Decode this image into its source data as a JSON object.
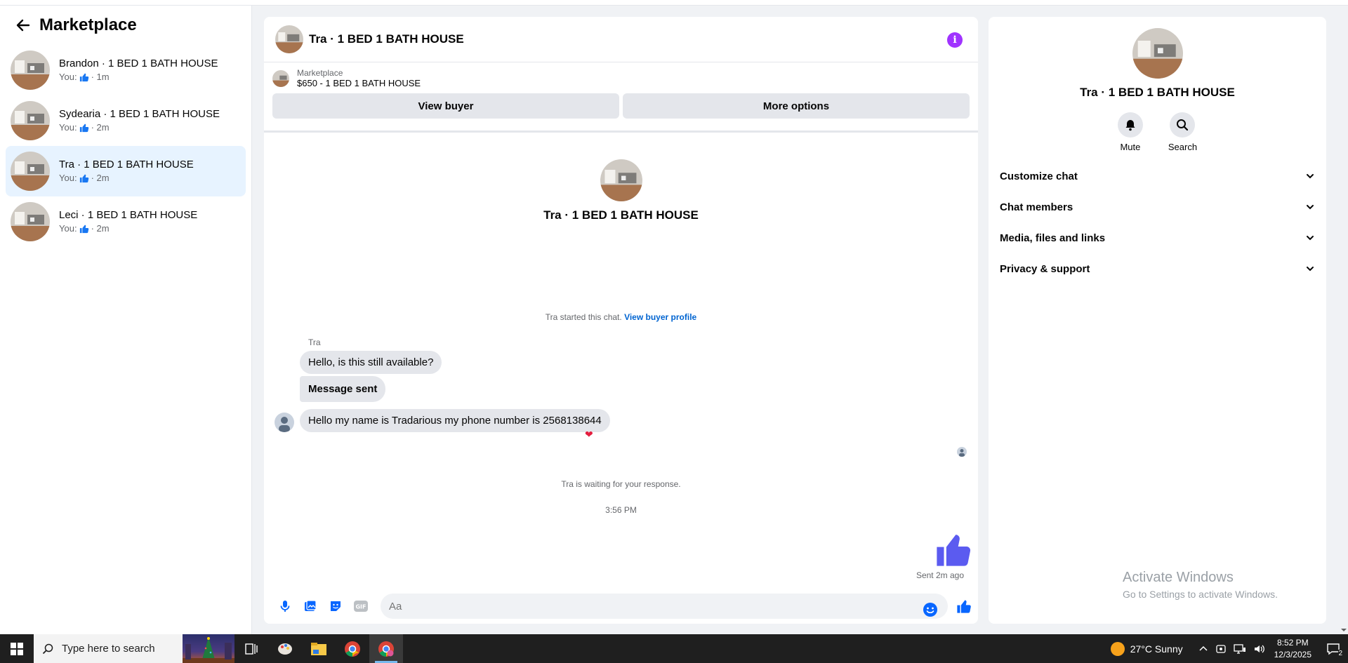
{
  "sidebar": {
    "title": "Marketplace",
    "conversations": [
      {
        "name": "Brandon · 1 BED 1 BATH HOUSE",
        "prefix": "You:",
        "time": "· 1m"
      },
      {
        "name": "Sydearia · 1 BED 1 BATH HOUSE",
        "prefix": "You:",
        "time": "· 2m"
      },
      {
        "name": "Tra · 1 BED 1 BATH HOUSE",
        "prefix": "You:",
        "time": "· 2m"
      },
      {
        "name": "Leci · 1 BED 1 BATH HOUSE",
        "prefix": "You:",
        "time": "· 2m"
      }
    ],
    "active_index": 2
  },
  "chat": {
    "header_title": "Tra · 1 BED 1 BATH HOUSE",
    "listing": {
      "label": "Marketplace",
      "price_title": "$650 - 1 BED 1 BATH HOUSE",
      "view_buyer": "View buyer",
      "more_options": "More options"
    },
    "intro_title": "Tra · 1 BED 1 BATH HOUSE",
    "started_text": "Tra started this chat.",
    "started_link": "View buyer profile",
    "sender_name": "Tra",
    "messages": [
      "Hello, is this still available?",
      "Message sent",
      "Hello my name is Tradarious my phone number is 2568138644"
    ],
    "waiting": "Tra is waiting for your response.",
    "timestamp": "3:56 PM",
    "sent_ago": "Sent 2m ago",
    "composer_placeholder": "Aa"
  },
  "right_panel": {
    "title": "Tra · 1 BED 1 BATH HOUSE",
    "actions": {
      "mute": "Mute",
      "search": "Search"
    },
    "sections": [
      "Customize chat",
      "Chat members",
      "Media, files and links",
      "Privacy & support"
    ]
  },
  "watermark": {
    "line1": "Activate Windows",
    "line2": "Go to Settings to activate Windows."
  },
  "taskbar": {
    "search_placeholder": "Type here to search",
    "weather": "27°C  Sunny",
    "time": "8:52 PM",
    "date": "12/3/2025",
    "notifications": "2"
  },
  "colors": {
    "accent_blue": "#0866ff",
    "info_purple": "#a033ff",
    "like_purple": "#5b5bf0",
    "active_row": "#e7f3ff"
  }
}
